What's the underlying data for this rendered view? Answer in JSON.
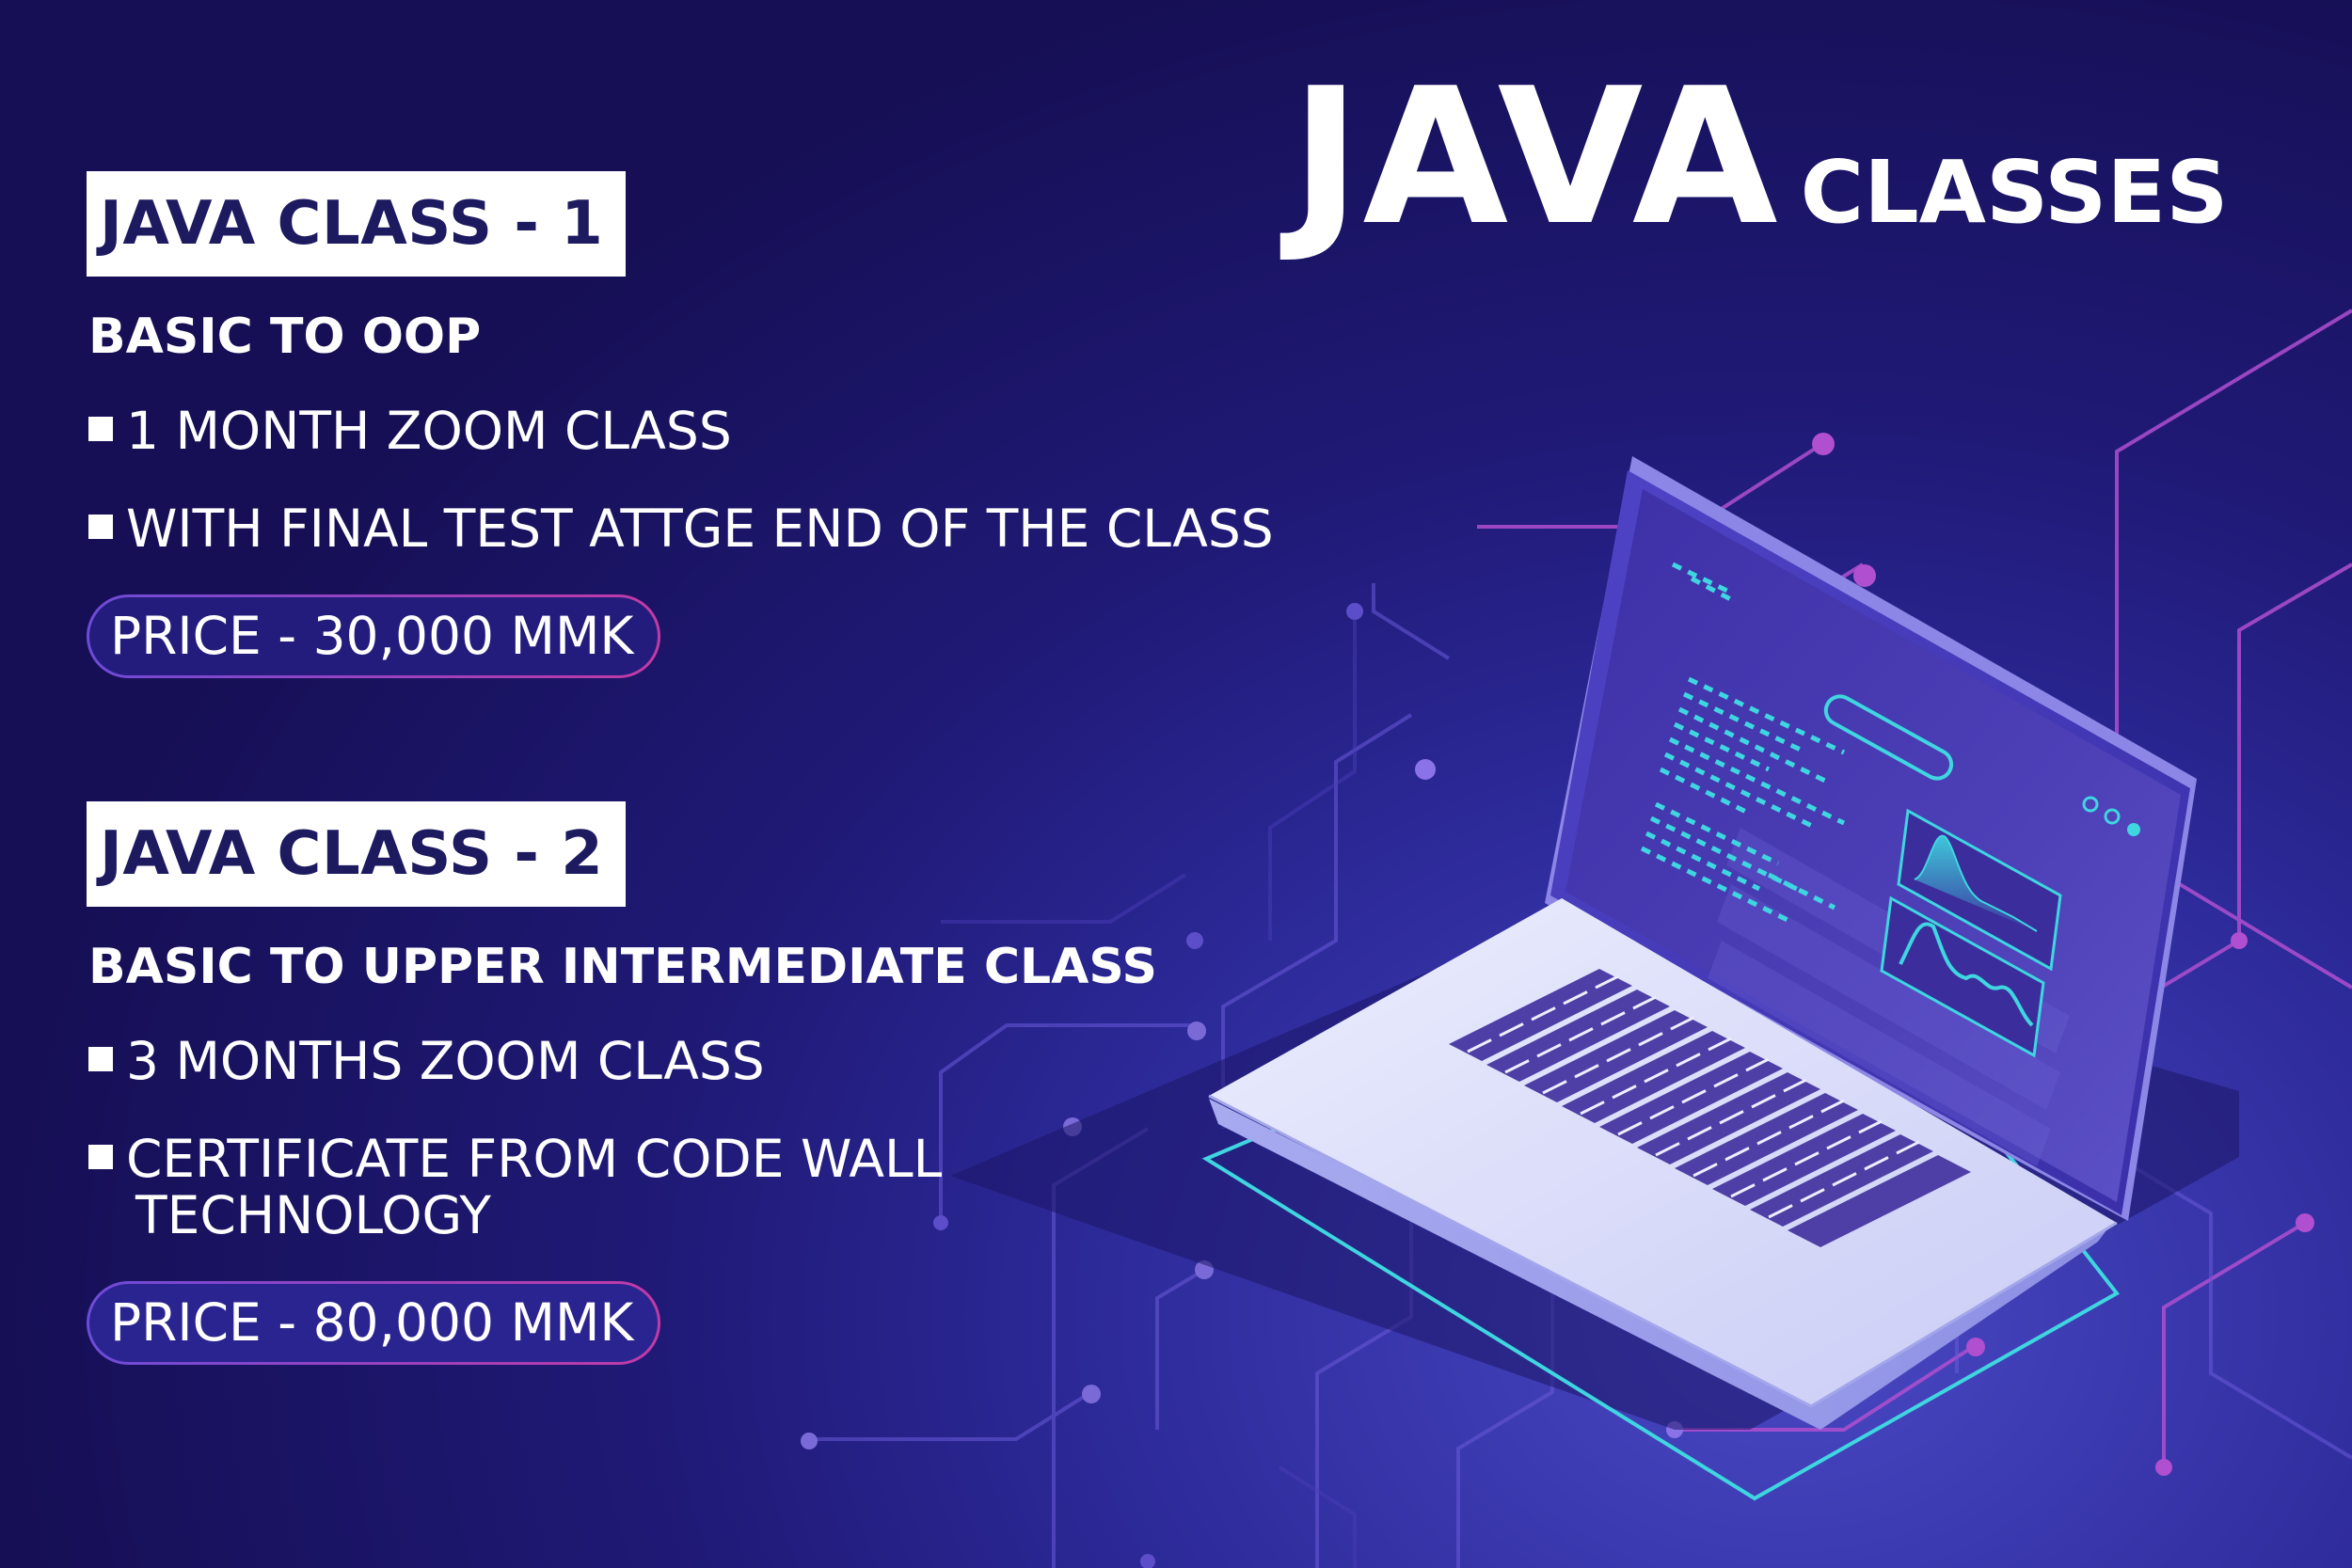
{
  "headline": {
    "main": "JAVA",
    "sub": "CLASSES"
  },
  "courses": [
    {
      "tag": "JAVA CLASS - 1",
      "subtitle": "BASIC TO OOP",
      "bullets": [
        "1 MONTH ZOOM CLASS",
        "WITH FINAL TEST ATTGE END OF THE CLASS"
      ],
      "price": "PRICE - 30,000 MMK"
    },
    {
      "tag": "JAVA CLASS - 2",
      "subtitle": "BASIC TO UPPER INTERMEDIATE CLASS",
      "bullets": [
        "3 MONTHS ZOOM CLASS",
        "CERTIFICATE FROM CODE WALL",
        "TECHNOLOGY"
      ],
      "price": "PRICE - 80,000 MMK"
    }
  ],
  "colors": {
    "background_dark": "#160f55",
    "background_light": "#4a49c4",
    "tag_text": "#1d1a60",
    "price_border_start": "#6d4bd8",
    "price_border_end": "#c23aa6",
    "screen_accent": "#3fd6e0",
    "laptop_body": "#d9dcfb",
    "circuit_line": "#b04fd0"
  },
  "illustration": {
    "name": "isometric-laptop-with-code-screen",
    "icons": [
      "laptop-icon",
      "code-lines-icon",
      "chart-panel-icon",
      "circuit-board-icon"
    ]
  }
}
